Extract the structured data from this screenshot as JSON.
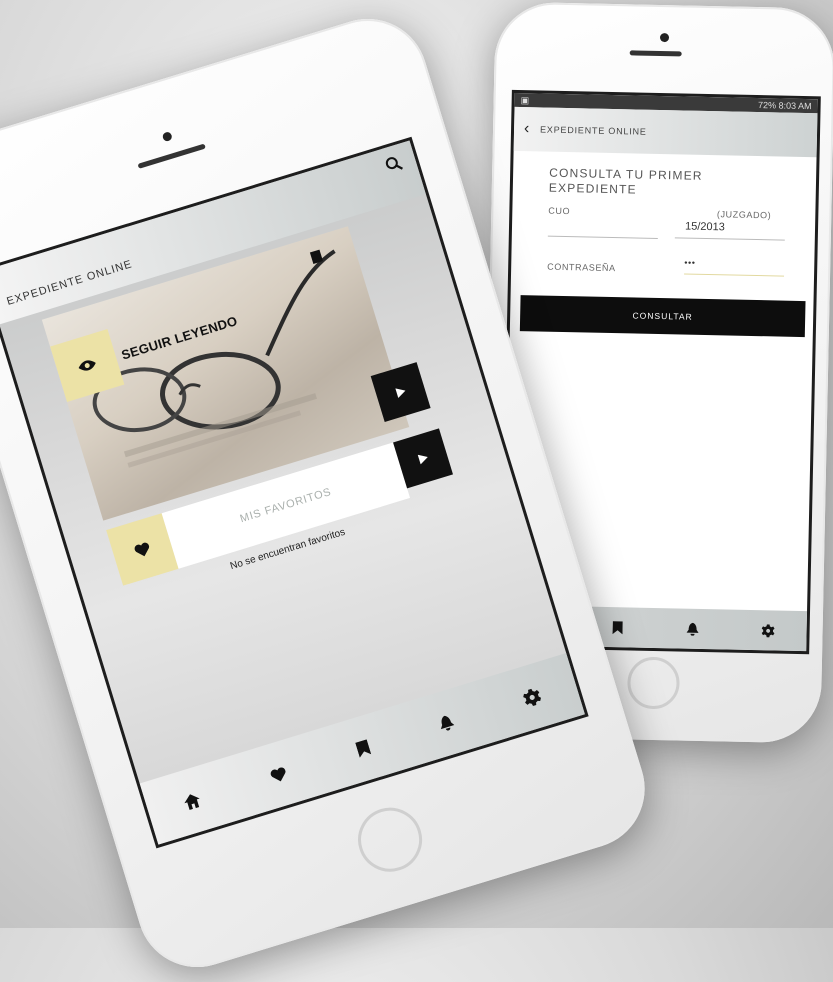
{
  "left_phone": {
    "header": {
      "title": "EXPEDIENTE ONLINE",
      "search_icon": "search-icon"
    },
    "card": {
      "label": "SEGUIR LEYENDO",
      "eye_icon": "eye-icon",
      "play_icon": "play-icon"
    },
    "favorites": {
      "label": "MIS FAVORITOS",
      "empty_message": "No se encuentran favoritos",
      "heart_icon": "heart-icon"
    },
    "tabbar": {
      "items": [
        "home-icon",
        "heart-icon",
        "bookmark-icon",
        "bell-icon",
        "gear-icon"
      ]
    }
  },
  "right_phone": {
    "status_bar": {
      "right": "72% 8:03 AM"
    },
    "header": {
      "title": "EXPEDIENTE ONLINE"
    },
    "form": {
      "title": "CONSULTA TU PRIMER EXPEDIENTE",
      "cuo_label": "CUO",
      "juzgado_label": "(JUZGADO)",
      "expediente_value": "15/2013",
      "password_label": "CONTRASEÑA",
      "password_value": "•••",
      "submit_label": "CONSULTAR"
    },
    "tabbar": {
      "items": [
        "heart-icon",
        "bookmark-icon",
        "bell-icon",
        "gear-icon"
      ]
    }
  },
  "colors": {
    "accent_yellow": "#ece2a6",
    "dark": "#111111",
    "header_gray": "#c8cdcd"
  }
}
